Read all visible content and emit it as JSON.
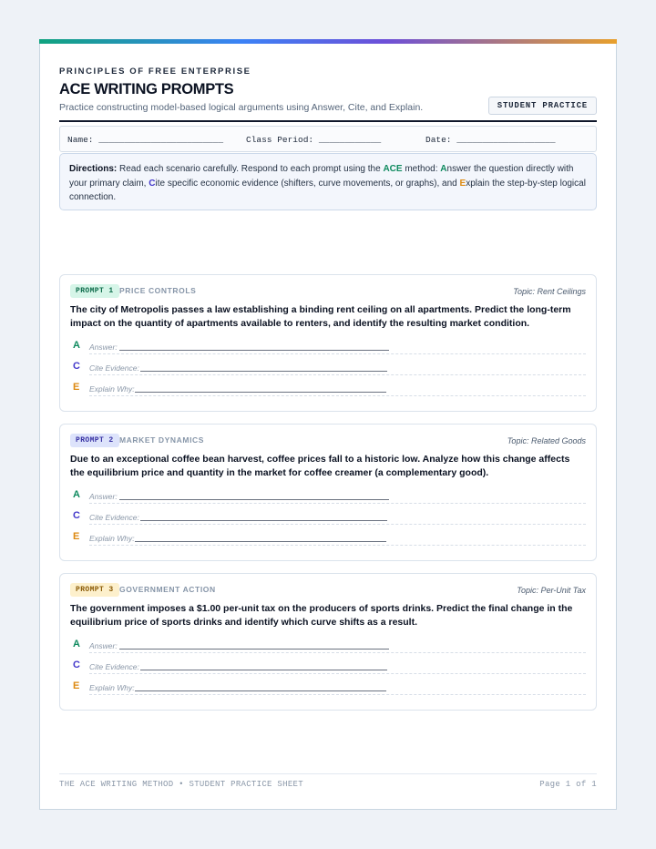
{
  "header": {
    "eyebrow": "PRINCIPLES OF FREE ENTERPRISE",
    "title": "ACE WRITING PROMPTS",
    "subtitle": "Practice constructing model-based logical arguments using Answer, Cite, and Explain.",
    "badge": "STUDENT PRACTICE"
  },
  "student_info": {
    "name": "Name: ________________________",
    "period": "Class Period: ____________",
    "date": "Date: ___________________"
  },
  "directions": {
    "label": "Directions:",
    "text_1": " Read each scenario carefully. Respond to each prompt using the ",
    "ace": "ACE",
    "text_2": " method: ",
    "a_letter": "A",
    "a_rest": "nswer the question directly with your primary claim, ",
    "c_letter": "C",
    "c_rest": "ite specific economic evidence (shifters, curve movements, or graphs), and ",
    "e_letter": "E",
    "e_rest": "xplain the step-by-step logical connection."
  },
  "ace_labels": {
    "a_letter": "A",
    "a_label": "Answer:",
    "c_letter": "C",
    "c_label": "Cite Evidence:",
    "e_letter": "E",
    "e_label": "Explain Why:"
  },
  "prompts": [
    {
      "badge": "PROMPT 1",
      "category": "PRICE CONTROLS",
      "topic": "Topic: Rent Ceilings",
      "text": "The city of Metropolis passes a law establishing a binding rent ceiling on all apartments. Predict the long-term impact on the quantity of apartments available to renters, and identify the resulting market condition."
    },
    {
      "badge": "PROMPT 2",
      "category": "MARKET DYNAMICS",
      "topic": "Topic: Related Goods",
      "text": "Due to an exceptional coffee bean harvest, coffee prices fall to a historic low. Analyze how this change affects the equilibrium price and quantity in the market for coffee creamer (a complementary good)."
    },
    {
      "badge": "PROMPT 3",
      "category": "GOVERNMENT ACTION",
      "topic": "Topic: Per-Unit Tax",
      "text": "The government imposes a $1.00 per-unit tax on the producers of sports drinks. Predict the final change in the equilibrium price of sports drinks and identify which curve shifts as a result."
    }
  ],
  "footer": {
    "left": "THE ACE WRITING METHOD • STUDENT PRACTICE SHEET",
    "right": "Page 1 of 1"
  },
  "colors": {
    "answer": "#0f8a5f",
    "cite": "#4338ca",
    "explain": "#dd8a12"
  }
}
